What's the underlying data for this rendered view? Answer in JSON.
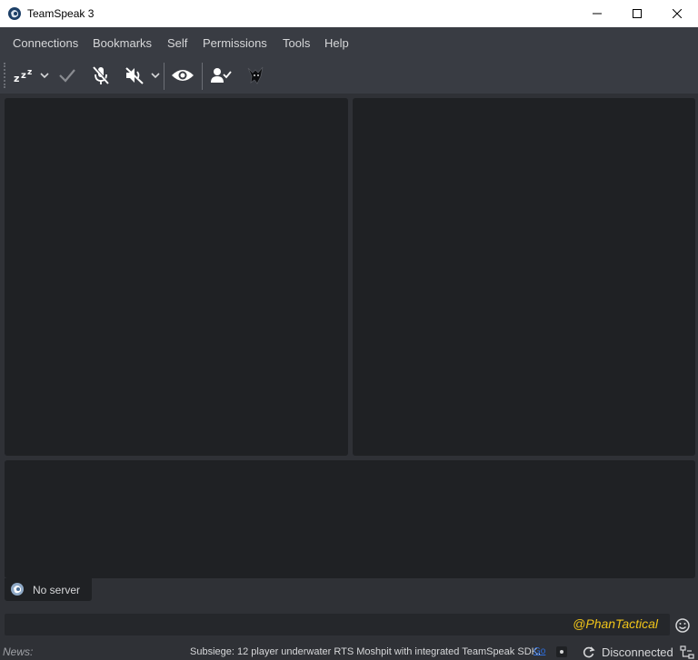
{
  "window": {
    "title": "TeamSpeak 3",
    "controls": [
      "minimize",
      "maximize",
      "close"
    ]
  },
  "menu": {
    "items": [
      "Connections",
      "Bookmarks",
      "Self",
      "Permissions",
      "Tools",
      "Help"
    ]
  },
  "toolbar": {
    "buttons": [
      "away-icon",
      "dropdown-arrow-icon",
      "checkmark-icon",
      "microphone-muted-icon",
      "speaker-muted-icon",
      "dropdown-arrow-icon",
      "eye-icon",
      "user-check-icon",
      "wolf-logo-icon"
    ]
  },
  "server_tab": {
    "label": "No server",
    "icon": "teamspeak-logo-icon"
  },
  "chat": {
    "input_value": "@PhanTactical",
    "input_color": "#f0c419",
    "emoji_button": "smiley-icon"
  },
  "statusbar": {
    "news_label": "News:",
    "news_text": "Subsiege: 12 player underwater RTS Moshpit with integrated TeamSpeak SDK.",
    "news_link": "Go",
    "status": "Disconnected"
  },
  "colors": {
    "background": "#2f3136",
    "panel": "#1f2124",
    "toolbar": "#393c43",
    "accent": "#f0c419"
  }
}
